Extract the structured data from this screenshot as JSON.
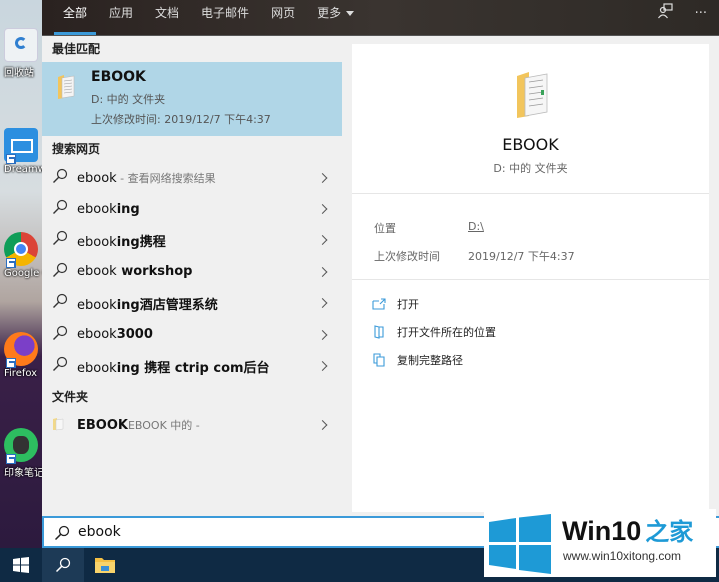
{
  "desktop": {
    "icons": [
      {
        "label": "回收站",
        "name": "recycle-bin"
      },
      {
        "label": "Dreamweaver",
        "name": "dreamweaver"
      },
      {
        "label": "Google Chrome",
        "name": "chrome"
      },
      {
        "label": "Firefox",
        "name": "firefox"
      },
      {
        "label": "印象笔记",
        "name": "evernote"
      }
    ]
  },
  "topbar": {
    "tabs": [
      {
        "label": "全部",
        "active": true
      },
      {
        "label": "应用"
      },
      {
        "label": "文档"
      },
      {
        "label": "电子邮件"
      },
      {
        "label": "网页"
      },
      {
        "label": "更多"
      }
    ],
    "feedback_icon": "feedback-icon",
    "more_options_label": "···"
  },
  "results": {
    "best_match_header": "最佳匹配",
    "best_match": {
      "title": "EBOOK",
      "subtitle": "D: 中的 文件夹",
      "modified": "上次修改时间: 2019/12/7 下午4:37"
    },
    "web_header": "搜索网页",
    "web_items": [
      {
        "prefix": "ebook",
        "bold": "",
        "suffix": " - 查看网络搜索结果"
      },
      {
        "prefix": "ebook",
        "bold": "ing",
        "suffix": ""
      },
      {
        "prefix": "ebook",
        "bold": "ing携程",
        "suffix": ""
      },
      {
        "prefix": "ebook",
        "bold": " workshop",
        "suffix": ""
      },
      {
        "prefix": "ebook",
        "bold": "ing酒店管理系统",
        "suffix": ""
      },
      {
        "prefix": "ebook",
        "bold": "3000",
        "suffix": ""
      },
      {
        "prefix": "ebook",
        "bold": "ing 携程 ctrip com后台",
        "suffix": ""
      }
    ],
    "folder_header": "文件夹",
    "folder_item": {
      "bold": "EBOOK",
      "muted": "EBOOK 中的 -"
    }
  },
  "preview": {
    "title": "EBOOK",
    "subtitle": "D: 中的 文件夹",
    "props": [
      {
        "label": "位置",
        "value": "D:\\",
        "link": true
      },
      {
        "label": "上次修改时间",
        "value": "2019/12/7 下午4:37",
        "link": false
      }
    ],
    "actions": [
      {
        "label": "打开",
        "icon": "open-icon"
      },
      {
        "label": "打开文件所在的位置",
        "icon": "folder-location-icon"
      },
      {
        "label": "复制完整路径",
        "icon": "copy-path-icon"
      }
    ]
  },
  "search": {
    "value": "ebook"
  },
  "colors": {
    "accent": "#3b9ad9",
    "selected_bg": "#b0d6e7",
    "taskbar": "#0f2a44"
  },
  "watermark": {
    "title": "Win10",
    "title_cn": "之家",
    "url": "www.win10xitong.com"
  }
}
